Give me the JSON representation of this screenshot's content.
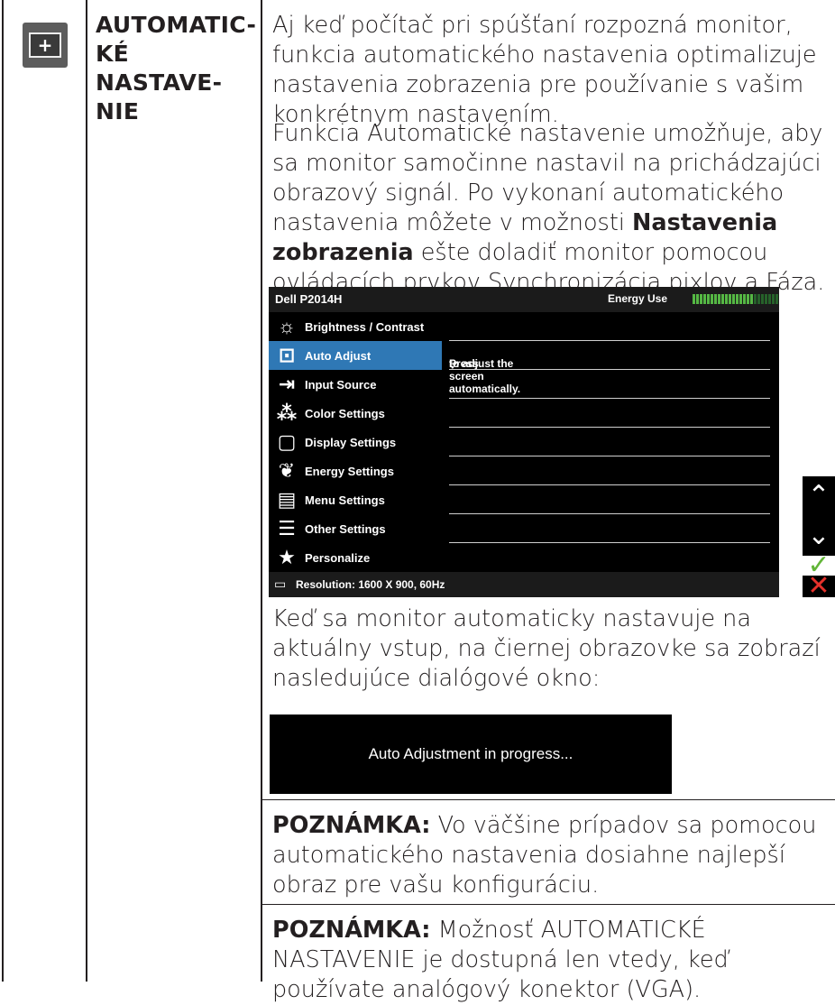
{
  "section_label": "AUTOMATIC-\nKÉ NASTAVE-\nNIE",
  "para1": "Aj keď počítač pri spúšťaní rozpozná monitor, funkcia automatického nastavenia optimalizuje nastavenia zobrazenia pre používanie s vašim konkrétnym nastavením.",
  "para2_a": "Funkcia Automatické nastavenie umožňuje, aby sa monitor samočinne nastavil na prichádzajúci obrazový signál. Po vykonaní automatického nastavenia môžete v možnosti ",
  "para2_bold": "Nastavenia zobrazenia",
  "para2_b": " ešte doladiť monitor pomocou ovládacích prvkov Synchronizácia pixlov a Fáza.",
  "osd": {
    "model": "Dell P2014H",
    "energy_label": "Energy Use",
    "energy_level": 0.72,
    "menu": [
      {
        "label": "Brightness / Contrast",
        "icon": "brightness-icon"
      },
      {
        "label": "Auto Adjust",
        "icon": "auto-adjust-icon",
        "selected": true
      },
      {
        "label": "Input Source",
        "icon": "input-source-icon"
      },
      {
        "label": "Color Settings",
        "icon": "color-settings-icon"
      },
      {
        "label": "Display Settings",
        "icon": "display-settings-icon"
      },
      {
        "label": "Energy Settings",
        "icon": "energy-settings-icon"
      },
      {
        "label": "Menu Settings",
        "icon": "menu-settings-icon"
      },
      {
        "label": "Other Settings",
        "icon": "other-settings-icon"
      },
      {
        "label": "Personalize",
        "icon": "star-icon"
      }
    ],
    "message_pre": "Press ",
    "message_check": "✓",
    "message_post": " to adjust the screen automatically.",
    "resolution": "Resolution: 1600 X 900, 60Hz"
  },
  "nav_buttons": {
    "up": "^",
    "down": "v",
    "ok": "✓",
    "exit": "✕"
  },
  "para3": "Keď sa monitor automaticky nastavuje na aktuálny vstup, na čiernej obrazovke sa zobrazí nasledujúce dialógové okno:",
  "progress_message": "Auto Adjustment in progress...",
  "note1_label": "POZNÁMKA:",
  "note1_text": " Vo väčšine prípadov sa pomocou automatického nastavenia dosiahne najlepší obraz pre vašu konfiguráciu.",
  "note2_label": "POZNÁMKA:",
  "note2_text": " Možnosť AUTOMATICKÉ NASTAVENIE je dostupná len vtedy, keď používate analógový konektor (VGA)."
}
